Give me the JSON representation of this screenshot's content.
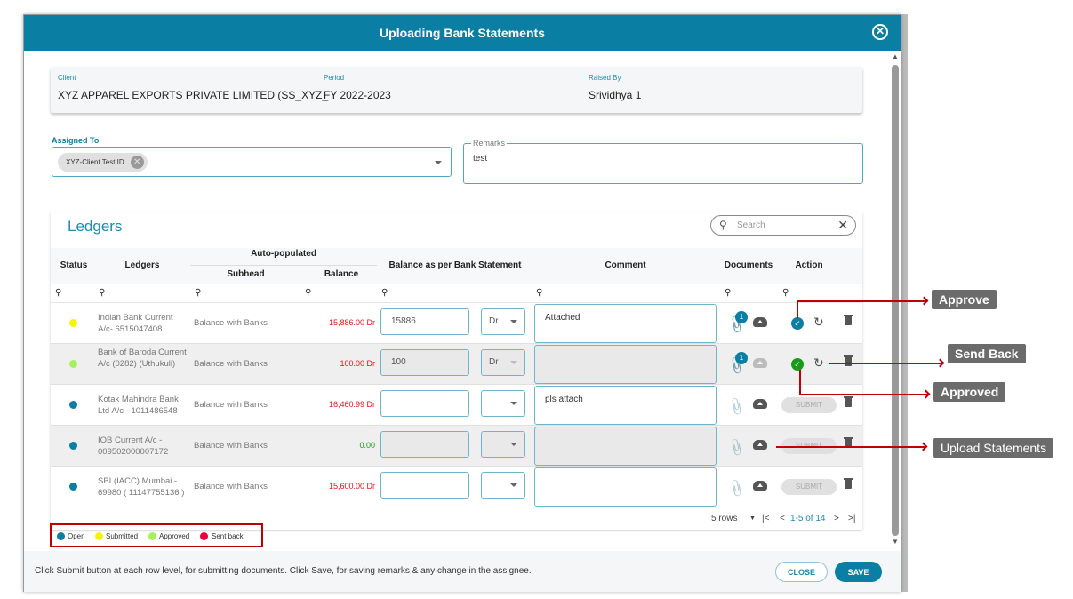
{
  "modal": {
    "title": "Uploading Bank Statements"
  },
  "info": {
    "client_label": "Client",
    "client": "XYZ APPAREL EXPORTS PRIVATE LIMITED (SS_XYZ_",
    "period_label": "Period",
    "period": "FY 2022-2023",
    "raised_label": "Raised By",
    "raised": "Srividhya 1"
  },
  "assigned": {
    "label": "Assigned To",
    "chip": "XYZ-Client Test ID"
  },
  "remarks": {
    "label": "Remarks",
    "value": "test"
  },
  "ledgers": {
    "title": "Ledgers",
    "search_placeholder": "Search",
    "headers": {
      "status": "Status",
      "ledgers": "Ledgers",
      "auto": "Auto-populated",
      "subhead": "Subhead",
      "balance": "Balance",
      "bank": "Balance as per Bank Statement",
      "comment": "Comment",
      "documents": "Documents",
      "action": "Action"
    },
    "rows": [
      {
        "status": "Submitted",
        "ledger": "Indian Bank Current A/c- 6515047408",
        "subhead": "Balance with Banks",
        "balance": "15,886.00 Dr",
        "bank": "15886",
        "drcr": "Dr",
        "comment": "Attached",
        "docs": "1",
        "submit": ""
      },
      {
        "status": "Approved",
        "ledger": "Bank of Baroda Current A/c (0282) (Uthukuli)",
        "subhead": "Balance with Banks",
        "balance": "100.00 Dr",
        "bank": "100",
        "drcr": "Dr",
        "comment": "",
        "docs": "1",
        "submit": ""
      },
      {
        "status": "Open",
        "ledger": "Kotak Mahindra Bank Ltd A/c - 1011486548",
        "subhead": "Balance with Banks",
        "balance": "16,460.99 Dr",
        "bank": "",
        "drcr": "",
        "comment": "pls attach",
        "docs": "",
        "submit": "SUBMIT"
      },
      {
        "status": "Open",
        "ledger": "IOB Current A/c - 009502000007172",
        "subhead": "Balance with Banks",
        "balance": "0.00",
        "bank": "",
        "drcr": "",
        "comment": "",
        "docs": "",
        "submit": "SUBMIT"
      },
      {
        "status": "Open",
        "ledger": "SBI (IACC) Mumbai - 69980 ( 11147755136 )",
        "subhead": "Balance with Banks",
        "balance": "15,600.00 Dr",
        "bank": "",
        "drcr": "",
        "comment": "",
        "docs": "",
        "submit": "SUBMIT"
      }
    ],
    "pager": {
      "rows": "5 rows",
      "range": "1-5 of 14"
    }
  },
  "legend": [
    {
      "label": "Open",
      "color": "#0b7fa3"
    },
    {
      "label": "Submitted",
      "color": "#f5f500"
    },
    {
      "label": "Approved",
      "color": "#a6f060"
    },
    {
      "label": "Sent back",
      "color": "#f0003c"
    }
  ],
  "footer": {
    "text": "Click Submit button at each row level, for submitting documents. Click Save, for saving remarks & any change in the assignee.",
    "close": "CLOSE",
    "save": "SAVE"
  },
  "callouts": {
    "approve": "Approve",
    "send_back": "Send Back",
    "approved": "Approved",
    "upload": "Upload Statements"
  }
}
